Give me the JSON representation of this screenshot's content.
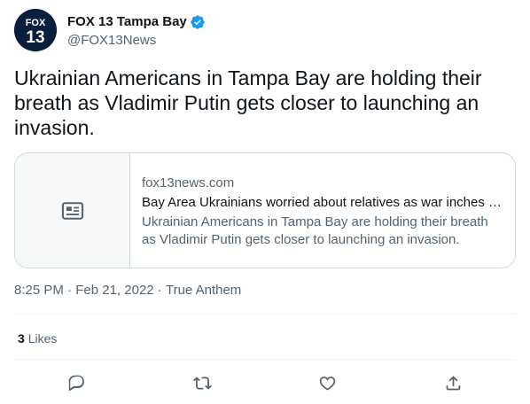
{
  "author": {
    "display_name": "FOX 13 Tampa Bay",
    "handle": "@FOX13News",
    "avatar_text_top": "FOX",
    "avatar_text_bottom": "13",
    "verified_color": "#1d9bf0"
  },
  "tweet": {
    "text": "Ukrainian Americans in Tampa Bay are holding their breath as Vladimir Putin gets closer to launching an invasion."
  },
  "card": {
    "icon": "news-article-icon",
    "domain": "fox13news.com",
    "title": "Bay Area Ukrainians worried about relatives as war inches closer",
    "description": "Ukrainian Americans in Tampa Bay are holding their breath as Vladimir Putin gets closer to launching an invasion."
  },
  "meta": {
    "time": "8:25 PM",
    "separator": " · ",
    "date": "Feb 21, 2022",
    "source": "True Anthem"
  },
  "stats": {
    "likes_count": "3",
    "likes_label": "Likes"
  },
  "actions": [
    {
      "name": "reply-icon"
    },
    {
      "name": "retweet-icon"
    },
    {
      "name": "like-icon"
    },
    {
      "name": "share-icon"
    }
  ],
  "colors": {
    "text_primary": "#0f1419",
    "text_secondary": "#536471",
    "border": "#cfd9de",
    "accent": "#1d9bf0"
  }
}
